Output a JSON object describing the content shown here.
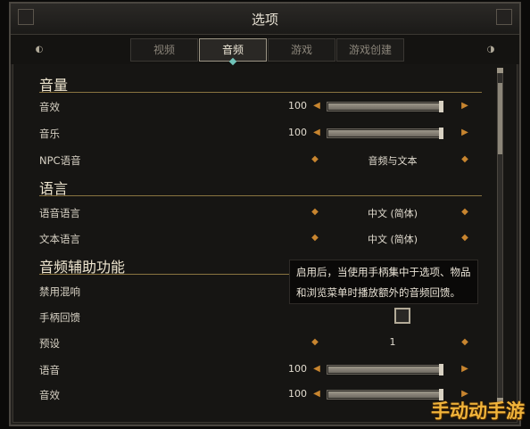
{
  "window": {
    "title": "选项"
  },
  "tabs": [
    {
      "label": "视频",
      "active": false
    },
    {
      "label": "音频",
      "active": true
    },
    {
      "label": "游戏",
      "active": false
    },
    {
      "label": "游戏创建",
      "active": false
    }
  ],
  "sections": {
    "volume": "音量",
    "language": "语言",
    "accessibility": "音频辅助功能"
  },
  "settings": {
    "sfx": {
      "label": "音效",
      "value": "100",
      "level": 1.0
    },
    "music": {
      "label": "音乐",
      "value": "100",
      "level": 1.0
    },
    "npc_voice": {
      "label": "NPC语音",
      "value": "音频与文本"
    },
    "voice_language": {
      "label": "语音语言",
      "value": "中文 (简体)"
    },
    "text_language": {
      "label": "文本语言",
      "value": "中文 (简体)"
    },
    "disable_mix": {
      "label": "禁用混响"
    },
    "controller_feedback": {
      "label": "手柄回馈",
      "checked": false
    },
    "preset": {
      "label": "预设",
      "value": "1"
    },
    "voice": {
      "label": "语音",
      "value": "100",
      "level": 1.0
    },
    "sfx2": {
      "label": "音效",
      "value": "100",
      "level": 1.0
    }
  },
  "tooltip": {
    "line1": "启用后，当使用手柄集中于选项、物品",
    "line2": "和浏览菜单时播放额外的音频回馈。"
  },
  "watermark": "手动动手游",
  "colors": {
    "accent": "#c8852f",
    "tab_marker": "#6fc3b8",
    "section_line": "#8a7440",
    "watermark": "#f0b33a"
  }
}
